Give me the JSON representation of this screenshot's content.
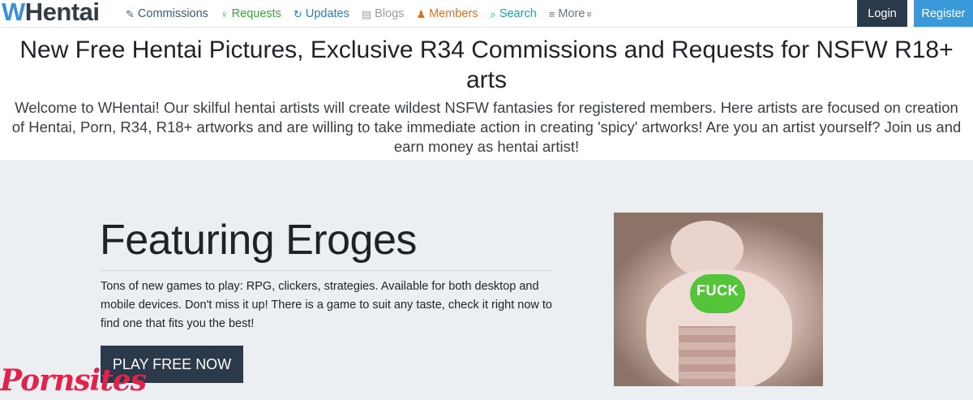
{
  "brand": {
    "logo_w": "W",
    "logo_rest": "Hentai"
  },
  "nav": {
    "items": [
      {
        "label": "Commissions",
        "icon": "gavel-icon",
        "glyph": "✎"
      },
      {
        "label": "Requests",
        "icon": "lightbulb-icon",
        "glyph": "♀"
      },
      {
        "label": "Updates",
        "icon": "refresh-icon",
        "glyph": "↻"
      },
      {
        "label": "Blogs",
        "icon": "newspaper-icon",
        "glyph": "▤"
      },
      {
        "label": "Members",
        "icon": "users-icon",
        "glyph": "♟"
      },
      {
        "label": "Search",
        "icon": "search-icon",
        "glyph": "⌕"
      },
      {
        "label": "More",
        "icon": "bars-icon",
        "glyph": "≡"
      }
    ],
    "more_caret": "»",
    "login": "Login",
    "register": "Register"
  },
  "intro": {
    "title": "New Free Hentai Pictures, Exclusive R34 Commissions and Requests for NSFW R18+ arts",
    "text": "Welcome to WHentai! Our skilful hentai artists will create wildest NSFW fantasies for registered members. Here artists are focused on creation of Hentai, Porn, R34, R18+ artworks and are willing to take immediate action in creating 'spicy' artworks! Are you an artist yourself? Join us and earn money as hentai artist!"
  },
  "feature": {
    "title": "Featuring Eroges",
    "description": "Tons of new games to play: RPG, clickers, strategies. Available for both desktop and mobile devices. Don't miss it up! There is a game to suit any taste, check it right now to find one that fits you the best!",
    "button": "PLAY FREE NOW",
    "image_badge": "FUCK"
  },
  "watermark": "Pornsites"
}
